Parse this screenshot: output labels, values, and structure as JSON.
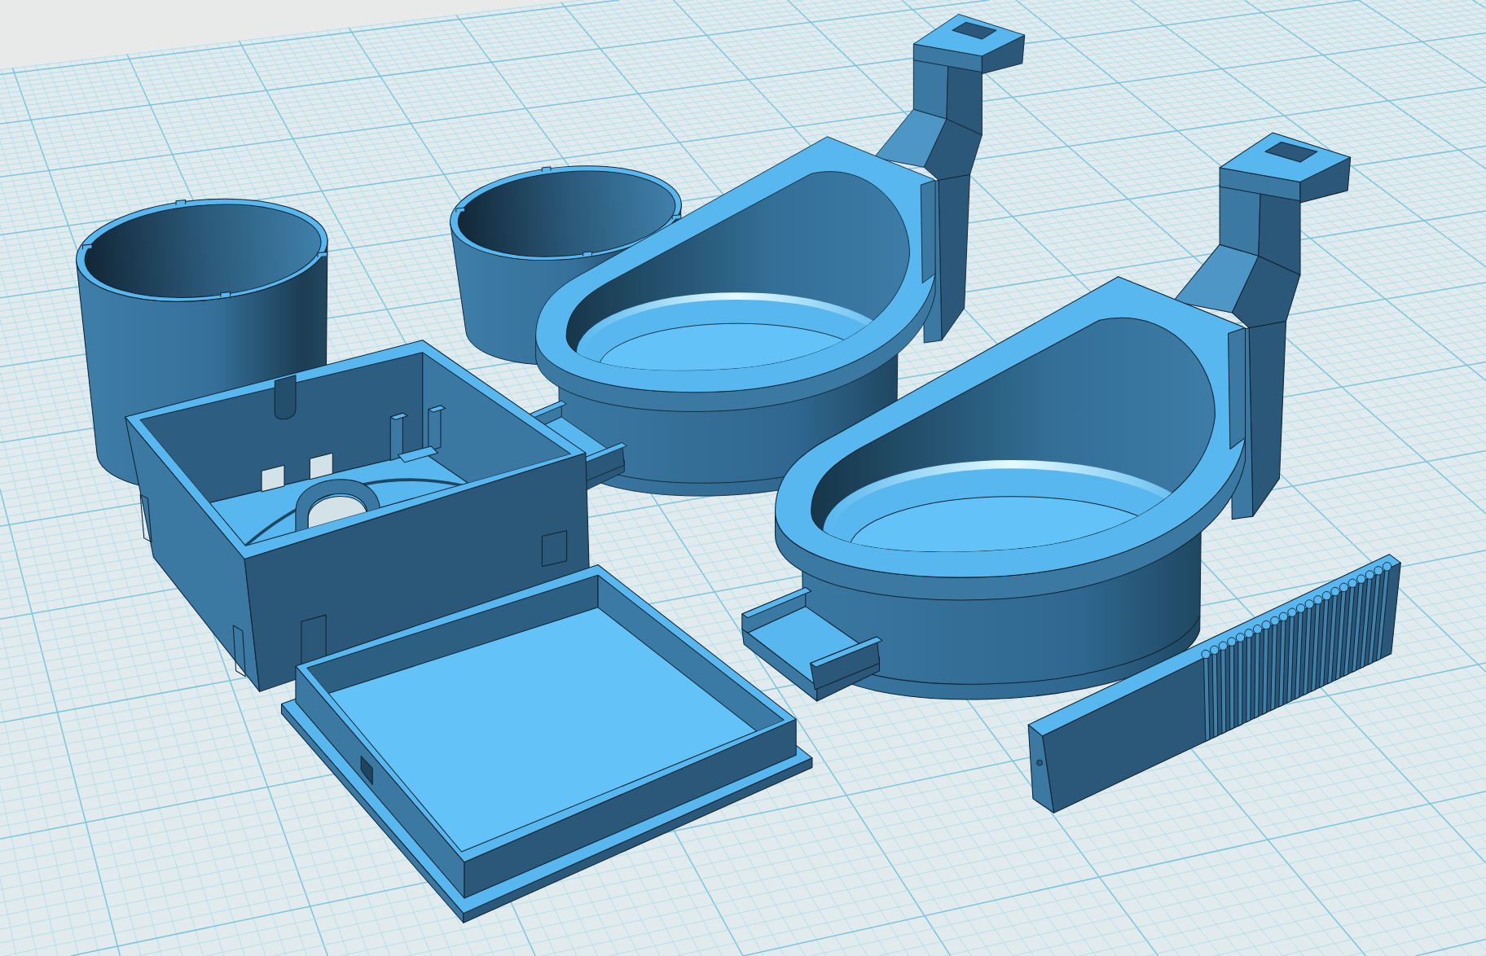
{
  "scene": {
    "parts": [
      {
        "kind": "cylinder"
      },
      {
        "kind": "cylinder"
      },
      {
        "kind": "cup-holder"
      },
      {
        "kind": "cup-holder"
      },
      {
        "kind": "enclosure"
      },
      {
        "kind": "tray"
      },
      {
        "kind": "rack"
      }
    ]
  }
}
